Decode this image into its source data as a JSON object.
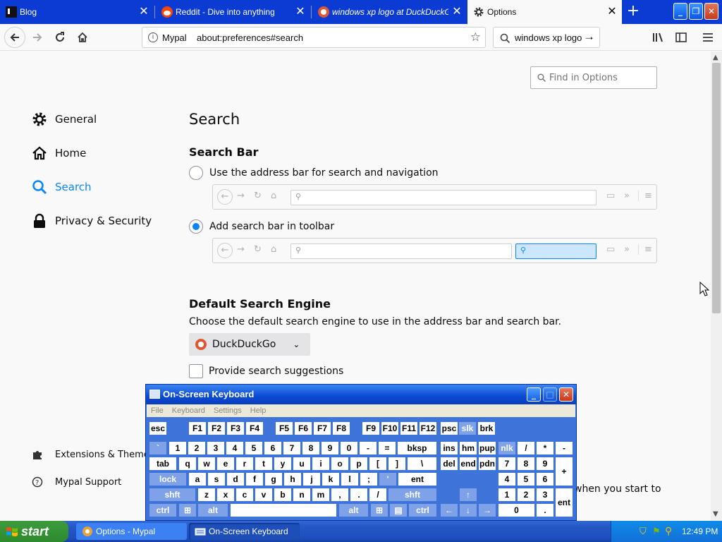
{
  "browser": {
    "tabs": [
      {
        "label": "Blog",
        "active": false
      },
      {
        "label": "Reddit - Dive into anything",
        "active": false
      },
      {
        "label": "windows xp logo at DuckDuckGo",
        "active": false
      },
      {
        "label": "Options",
        "active": true
      }
    ],
    "new_tab": "+",
    "window_buttons": {
      "minimize": "_",
      "restore": "❐",
      "close": "✕"
    },
    "url": {
      "identity": "Mypal",
      "address": "about:preferences#search"
    },
    "search": {
      "value": "windows xp logo"
    }
  },
  "preferences": {
    "find_placeholder": "Find in Options",
    "categories": [
      {
        "label": "General",
        "selected": false
      },
      {
        "label": "Home",
        "selected": false
      },
      {
        "label": "Search",
        "selected": true
      },
      {
        "label": "Privacy & Security",
        "selected": false
      }
    ],
    "footer_links": [
      {
        "label": "Extensions & Themes"
      },
      {
        "label": "Mypal Support"
      }
    ],
    "page_title": "Search",
    "search_bar": {
      "heading": "Search Bar",
      "option_address": "Use the address bar for search and navigation",
      "option_toolbar": "Add search bar in toolbar",
      "selected": "toolbar"
    },
    "default_engine": {
      "heading": "Default Search Engine",
      "description": "Choose the default search engine to use in the address bar and search bar.",
      "selected": "DuckDuckGo"
    },
    "suggestions_label": "Provide search suggestions",
    "partial_text": "when you start to"
  },
  "osk": {
    "title": "On-Screen Keyboard",
    "menu": [
      "File",
      "Keyboard",
      "Settings",
      "Help"
    ]
  },
  "taskbar": {
    "start": "start",
    "tasks": [
      {
        "label": "Options - Mypal",
        "active": false
      },
      {
        "label": "On-Screen Keyboard",
        "active": true
      }
    ],
    "clock": "12:49 PM"
  },
  "colors": {
    "accent": "#0a84ff",
    "tabbar": "#0c3bd4",
    "taskbar": "#245edb",
    "start": "#3c9c3c"
  }
}
